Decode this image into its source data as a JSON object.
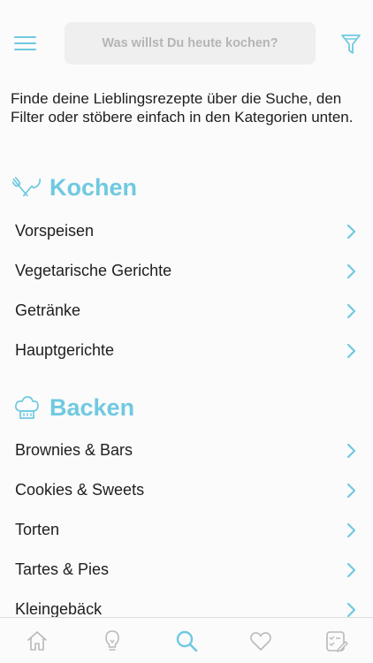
{
  "search": {
    "placeholder": "Was willst Du heute kochen?"
  },
  "intro": "Finde deine Lieblingsrezepte über die Suche, den Filter oder stöbere einfach in den Kategorien unten.",
  "sections": [
    {
      "title": "Kochen",
      "icon": "utensils-icon",
      "items": [
        "Vorspeisen",
        "Vegetarische Gerichte",
        "Getränke",
        "Hauptgerichte"
      ]
    },
    {
      "title": "Backen",
      "icon": "chef-hat-icon",
      "items": [
        "Brownies & Bars",
        "Cookies & Sweets",
        "Torten",
        "Tartes & Pies",
        "Kleingebäck"
      ]
    }
  ],
  "tabs": [
    {
      "icon": "home-icon",
      "active": false
    },
    {
      "icon": "lightbulb-icon",
      "active": false
    },
    {
      "icon": "search-icon",
      "active": true
    },
    {
      "icon": "heart-icon",
      "active": false
    },
    {
      "icon": "checklist-icon",
      "active": false
    }
  ],
  "colors": {
    "accent": "#6fc9e0",
    "inactive": "#b9b9b9",
    "text": "#1e1e1e",
    "searchBg": "#efefef"
  }
}
